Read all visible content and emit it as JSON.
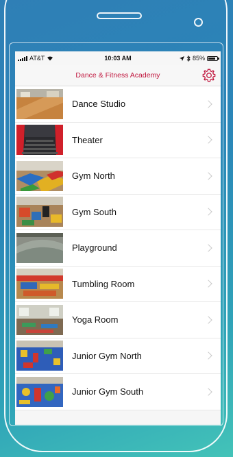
{
  "status": {
    "carrier": "AT&T",
    "time": "10:03 AM",
    "battery": "85%",
    "battery_level": 0.85
  },
  "nav": {
    "title": "Dance & Fitness Academy",
    "settings_icon": "gear-icon",
    "accent_color": "#c0143c"
  },
  "rooms": [
    {
      "label": "Dance Studio"
    },
    {
      "label": "Theater"
    },
    {
      "label": "Gym North"
    },
    {
      "label": "Gym South"
    },
    {
      "label": "Playground"
    },
    {
      "label": "Tumbling Room"
    },
    {
      "label": "Yoga Room"
    },
    {
      "label": "Junior Gym North"
    },
    {
      "label": "Junior Gym South"
    }
  ]
}
